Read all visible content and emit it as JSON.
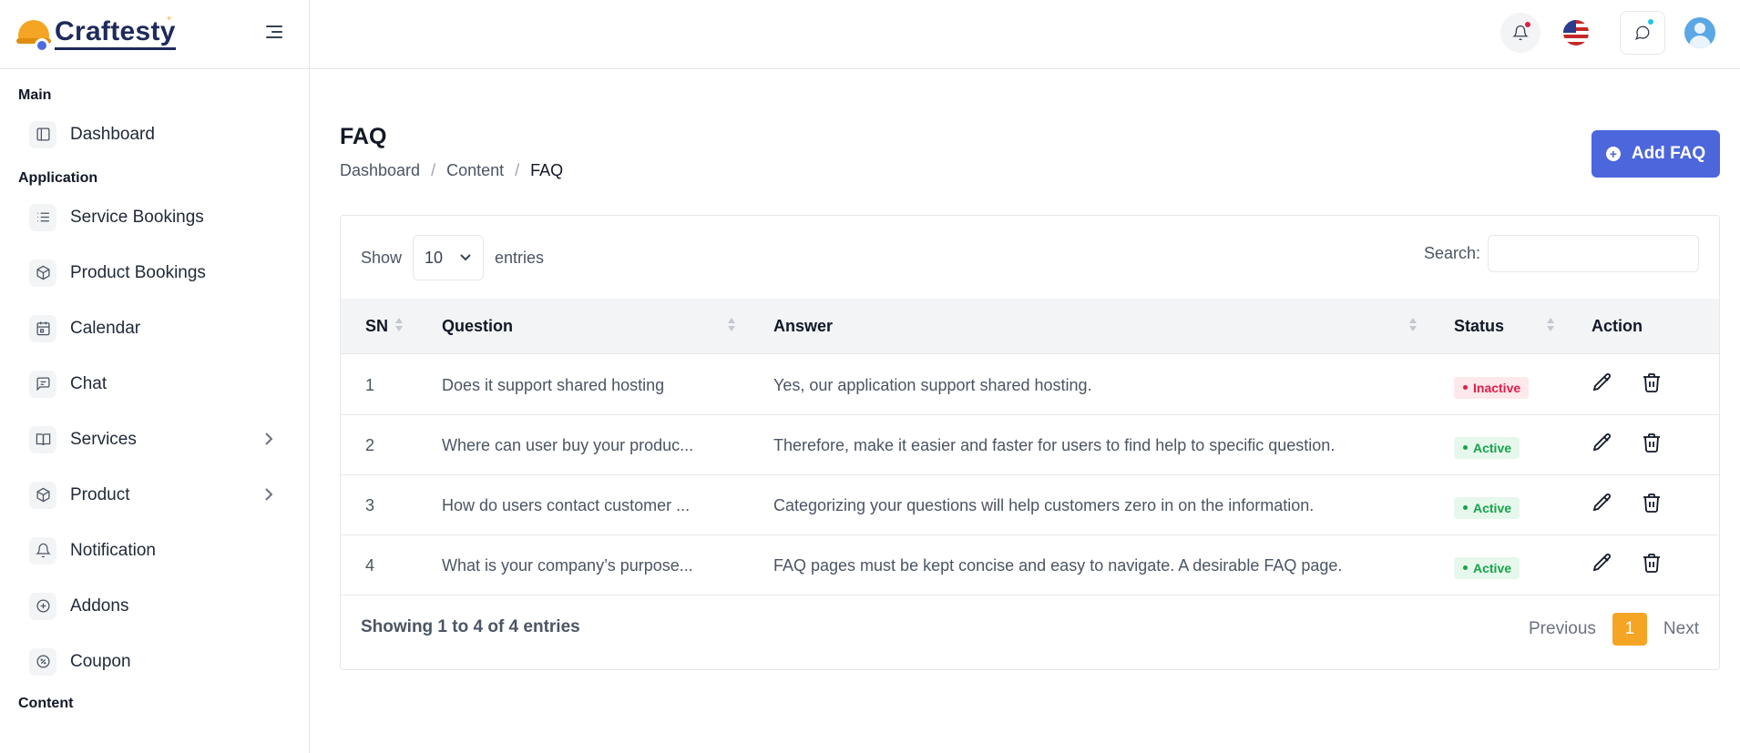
{
  "app": {
    "name": "Craftesty"
  },
  "sidebar": {
    "sections": [
      {
        "title": "Main",
        "items": [
          {
            "label": "Dashboard",
            "icon": "layout-icon"
          }
        ]
      },
      {
        "title": "Application",
        "items": [
          {
            "label": "Service Bookings",
            "icon": "list-icon"
          },
          {
            "label": "Product Bookings",
            "icon": "box-icon"
          },
          {
            "label": "Calendar",
            "icon": "calendar-icon"
          },
          {
            "label": "Chat",
            "icon": "message-icon"
          },
          {
            "label": "Services",
            "icon": "book-icon",
            "has_submenu": true
          },
          {
            "label": "Product",
            "icon": "box-icon",
            "has_submenu": true
          },
          {
            "label": "Notification",
            "icon": "bell-icon"
          },
          {
            "label": "Addons",
            "icon": "plus-circle-icon"
          },
          {
            "label": "Coupon",
            "icon": "percent-icon"
          }
        ]
      },
      {
        "title": "Content",
        "items": []
      }
    ]
  },
  "header": {
    "title": "FAQ",
    "breadcrumb": [
      "Dashboard",
      "Content",
      "FAQ"
    ],
    "add_button": "Add FAQ"
  },
  "table_controls": {
    "show_label": "Show",
    "entries_value": "10",
    "entries_label": "entries",
    "search_label": "Search:",
    "search_value": ""
  },
  "table": {
    "columns": [
      "SN",
      "Question",
      "Answer",
      "Status",
      "Action"
    ],
    "rows": [
      {
        "sn": "1",
        "question": "Does it support shared hosting",
        "answer": "Yes, our application support shared hosting.",
        "status": "Inactive"
      },
      {
        "sn": "2",
        "question": "Where can user buy your produc...",
        "answer": "Therefore, make it easier and faster for users to find help to specific question.",
        "status": "Active"
      },
      {
        "sn": "3",
        "question": "How do users contact customer ...",
        "answer": "Categorizing your questions will help customers zero in on the information.",
        "status": "Active"
      },
      {
        "sn": "4",
        "question": "What is your company’s purpose...",
        "answer": "FAQ pages must be kept concise and easy to navigate. A desirable FAQ page.",
        "status": "Active"
      }
    ]
  },
  "footer": {
    "showing": "Showing 1 to 4 of 4 entries",
    "previous": "Previous",
    "page": "1",
    "next": "Next"
  },
  "colors": {
    "primary": "#4c66dc",
    "accent": "#f5a524",
    "inactive": "#e11d48",
    "active": "#16a34a"
  }
}
